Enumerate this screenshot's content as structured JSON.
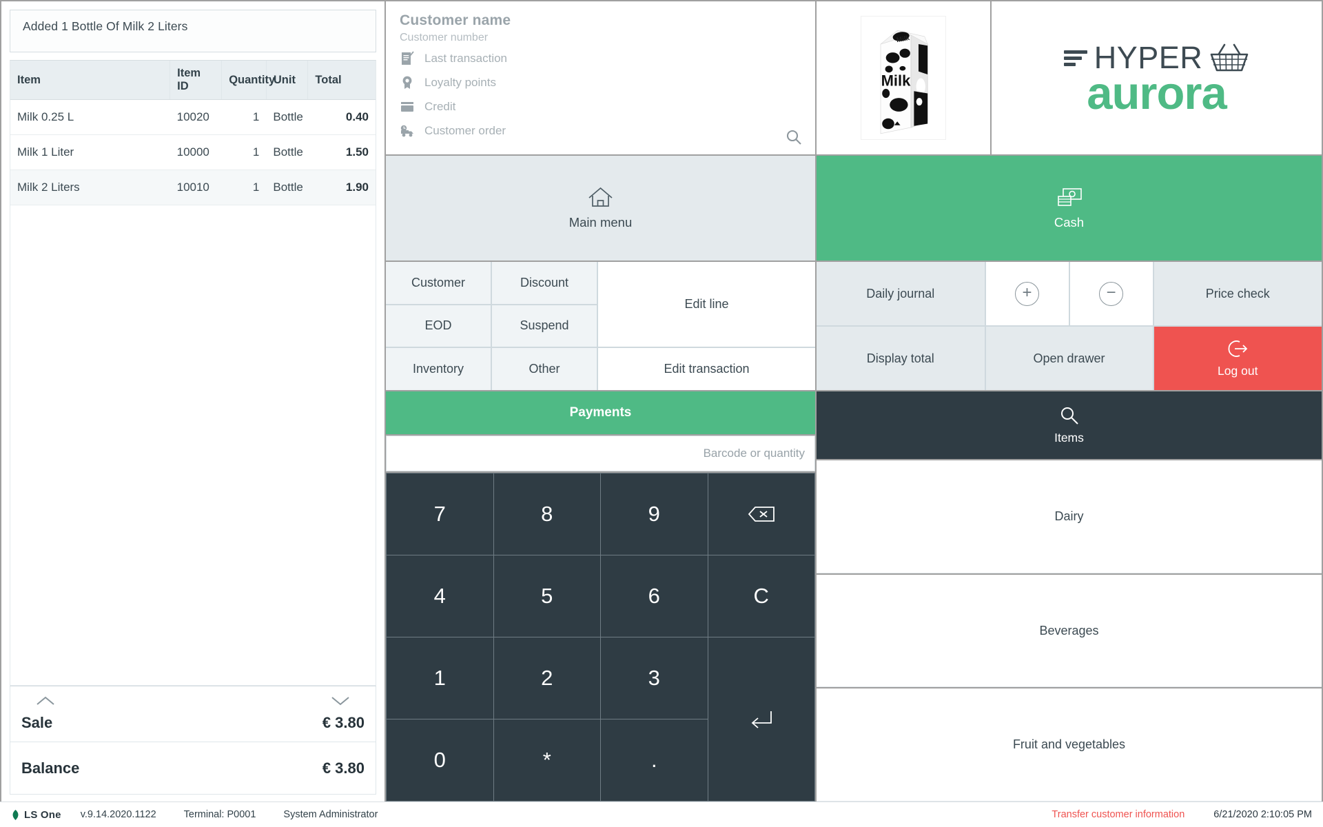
{
  "receipt": {
    "message": "Added 1 Bottle Of Milk 2 Liters",
    "columns": [
      "Item",
      "Item ID",
      "Quantity",
      "Unit",
      "Total"
    ],
    "rows": [
      {
        "item": "Milk 0.25 L",
        "item_id": "10020",
        "quantity": "1",
        "unit": "Bottle",
        "total": "0.40"
      },
      {
        "item": "Milk 1 Liter",
        "item_id": "10000",
        "quantity": "1",
        "unit": "Bottle",
        "total": "1.50"
      },
      {
        "item": "Milk 2 Liters",
        "item_id": "10010",
        "quantity": "1",
        "unit": "Bottle",
        "total": "1.90"
      }
    ],
    "sale_label": "Sale",
    "sale_value": "€ 3.80",
    "balance_label": "Balance",
    "balance_value": "€ 3.80"
  },
  "customer": {
    "name": "Customer name",
    "number": "Customer number",
    "links": [
      {
        "label": "Last transaction",
        "icon": "document-check-icon"
      },
      {
        "label": "Loyalty points",
        "icon": "award-ribbon-icon"
      },
      {
        "label": "Credit",
        "icon": "credit-card-icon"
      },
      {
        "label": "Customer order",
        "icon": "delivery-truck-icon"
      }
    ],
    "search_icon": "search-icon"
  },
  "branding": {
    "product_image_alt": "Milk",
    "milk_label_top": "Milk",
    "milk_label_front": "Milk",
    "logo_word": "HYPER",
    "logo_word2": "aurora",
    "logo_basket_icon": "shopping-basket-icon",
    "green": "#4fba85",
    "dark": "#3d4a52"
  },
  "main_menu": {
    "label": "Main menu",
    "icon": "home-icon"
  },
  "actions": {
    "customer": "Customer",
    "discount": "Discount",
    "eod": "EOD",
    "suspend": "Suspend",
    "inventory": "Inventory",
    "other": "Other",
    "edit_line": "Edit line",
    "edit_transaction": "Edit transaction",
    "payments": "Payments"
  },
  "input": {
    "placeholder": "Barcode or quantity",
    "value": ""
  },
  "keypad": {
    "keys": [
      {
        "label": "7",
        "icon": null
      },
      {
        "label": "8",
        "icon": null
      },
      {
        "label": "9",
        "icon": null
      },
      {
        "label": "",
        "icon": "backspace-icon"
      },
      {
        "label": "4",
        "icon": null
      },
      {
        "label": "5",
        "icon": null
      },
      {
        "label": "6",
        "icon": null
      },
      {
        "label": "C",
        "icon": null
      },
      {
        "label": "1",
        "icon": null
      },
      {
        "label": "2",
        "icon": null
      },
      {
        "label": "3",
        "icon": null
      },
      {
        "label": "",
        "icon": "enter-icon"
      },
      {
        "label": "0",
        "icon": null
      },
      {
        "label": "*",
        "icon": null
      },
      {
        "label": ".",
        "icon": null
      }
    ]
  },
  "cash": {
    "label": "Cash",
    "icon": "banknotes-icon"
  },
  "right_grid": {
    "daily_journal": "Daily journal",
    "plus": "+",
    "minus": "−",
    "price_check": "Price check",
    "display_total": "Display total",
    "open_drawer": "Open drawer",
    "log_out": "Log out",
    "log_out_icon": "logout-arrow-icon"
  },
  "items_panel": {
    "search_label": "Items",
    "search_icon": "search-icon",
    "categories": [
      "Dairy",
      "Beverages",
      "Fruit and  vegetables"
    ]
  },
  "statusbar": {
    "app_name": "LS One",
    "version": "v.9.14.2020.1122",
    "terminal": "Terminal: P0001",
    "user": "System Administrator",
    "transfer": "Transfer customer information",
    "timestamp": "6/21/2020 2:10:05 PM",
    "transfer_color": "#ef5350"
  }
}
